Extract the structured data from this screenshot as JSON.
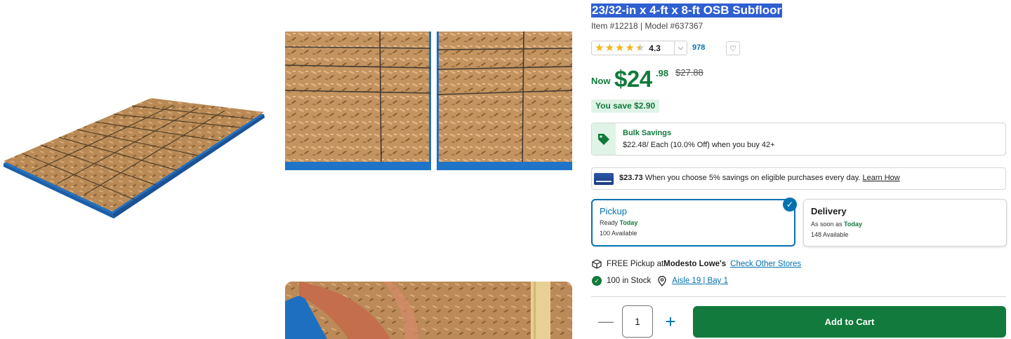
{
  "product": {
    "title": "23/32-in x 4-ft x 8-ft OSB Subfloor",
    "item_line": "Item #12218 | Model #637367",
    "rating_value": "4.3",
    "rating_stars": 4.3,
    "review_count": "978"
  },
  "price": {
    "now_label": "Now",
    "dollars": "$24",
    "cents": ".98",
    "was": "$27.88",
    "savings": "You save $2.90"
  },
  "bulk": {
    "title": "Bulk Savings",
    "description": "$22.48/ Each (10.0% Off) when you buy 42+"
  },
  "card_offer": {
    "amount": "$23.73",
    "text": " When you choose 5% savings on eligible purchases every day. ",
    "link": "Learn How"
  },
  "pickup": {
    "title": "Pickup",
    "ready_prefix": "Ready ",
    "ready_when": "Today",
    "available": "100 Available",
    "selected": true
  },
  "delivery": {
    "title": "Delivery",
    "soon_prefix": "As soon as ",
    "soon_when": "Today",
    "available": "148 Available"
  },
  "store": {
    "free_pickup_prefix": "FREE Pickup at ",
    "store_name": "Modesto Lowe's",
    "check_other": "Check Other Stores",
    "stock": "100 in Stock",
    "aisle": "Aisle 19 | Bay 1"
  },
  "cart": {
    "quantity": "1",
    "add_label": "Add to Cart",
    "minus_symbol": "—",
    "plus_symbol": "+"
  },
  "colors": {
    "brand_green": "#117a3c",
    "link_blue": "#0471af",
    "star_gold": "#f3b41b"
  }
}
